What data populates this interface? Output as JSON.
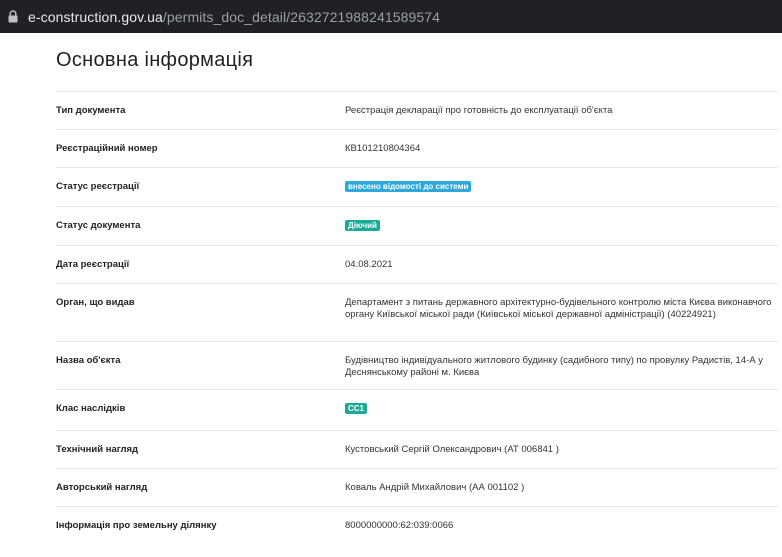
{
  "browser": {
    "url_host": "e-construction.gov.ua",
    "url_path": "/permits_doc_detail/2632721988241589574"
  },
  "section": {
    "title": "Основна інформація"
  },
  "rows": [
    {
      "label": "Тип документа",
      "value": "Реєстрація декларації про готовність до експлуатації об'єкта"
    },
    {
      "label": "Реєстраційний номер",
      "value": "КВ101210804364"
    },
    {
      "label": "Статус реєстрації",
      "badge": "внесено відомості до системи",
      "badge_color": "#2ea7d9"
    },
    {
      "label": "Статус документа",
      "badge": "Діючий",
      "badge_color": "#1bab95"
    },
    {
      "label": "Дата реєстрації",
      "value": "04.08.2021"
    },
    {
      "label": "Орган, що видав",
      "value": "Департамент з питань державного архітектурно-будівельного контролю міста Києва виконавчого органу Київської міської ради (Київської міської державної адміністрації) (40224921)"
    },
    {
      "label": "Назва об'єкта",
      "value": "Будівництво індивідуального житлового будинку (садибного типу) по провулку Радистів, 14-А у Деснянському районі м. Києва"
    },
    {
      "label": "Клас наслідків",
      "badge": "СС1",
      "badge_color": "#1bab95"
    },
    {
      "label": "Технічний нагляд",
      "value": "Кустовський Сергій Олександрович (АТ 006841 )"
    },
    {
      "label": "Авторський нагляд",
      "value": "Коваль Андрій Михайлович (АА 001102 )"
    },
    {
      "label": "Інформація про земельну ділянку",
      "value": "8000000000:62:039:0066"
    }
  ]
}
